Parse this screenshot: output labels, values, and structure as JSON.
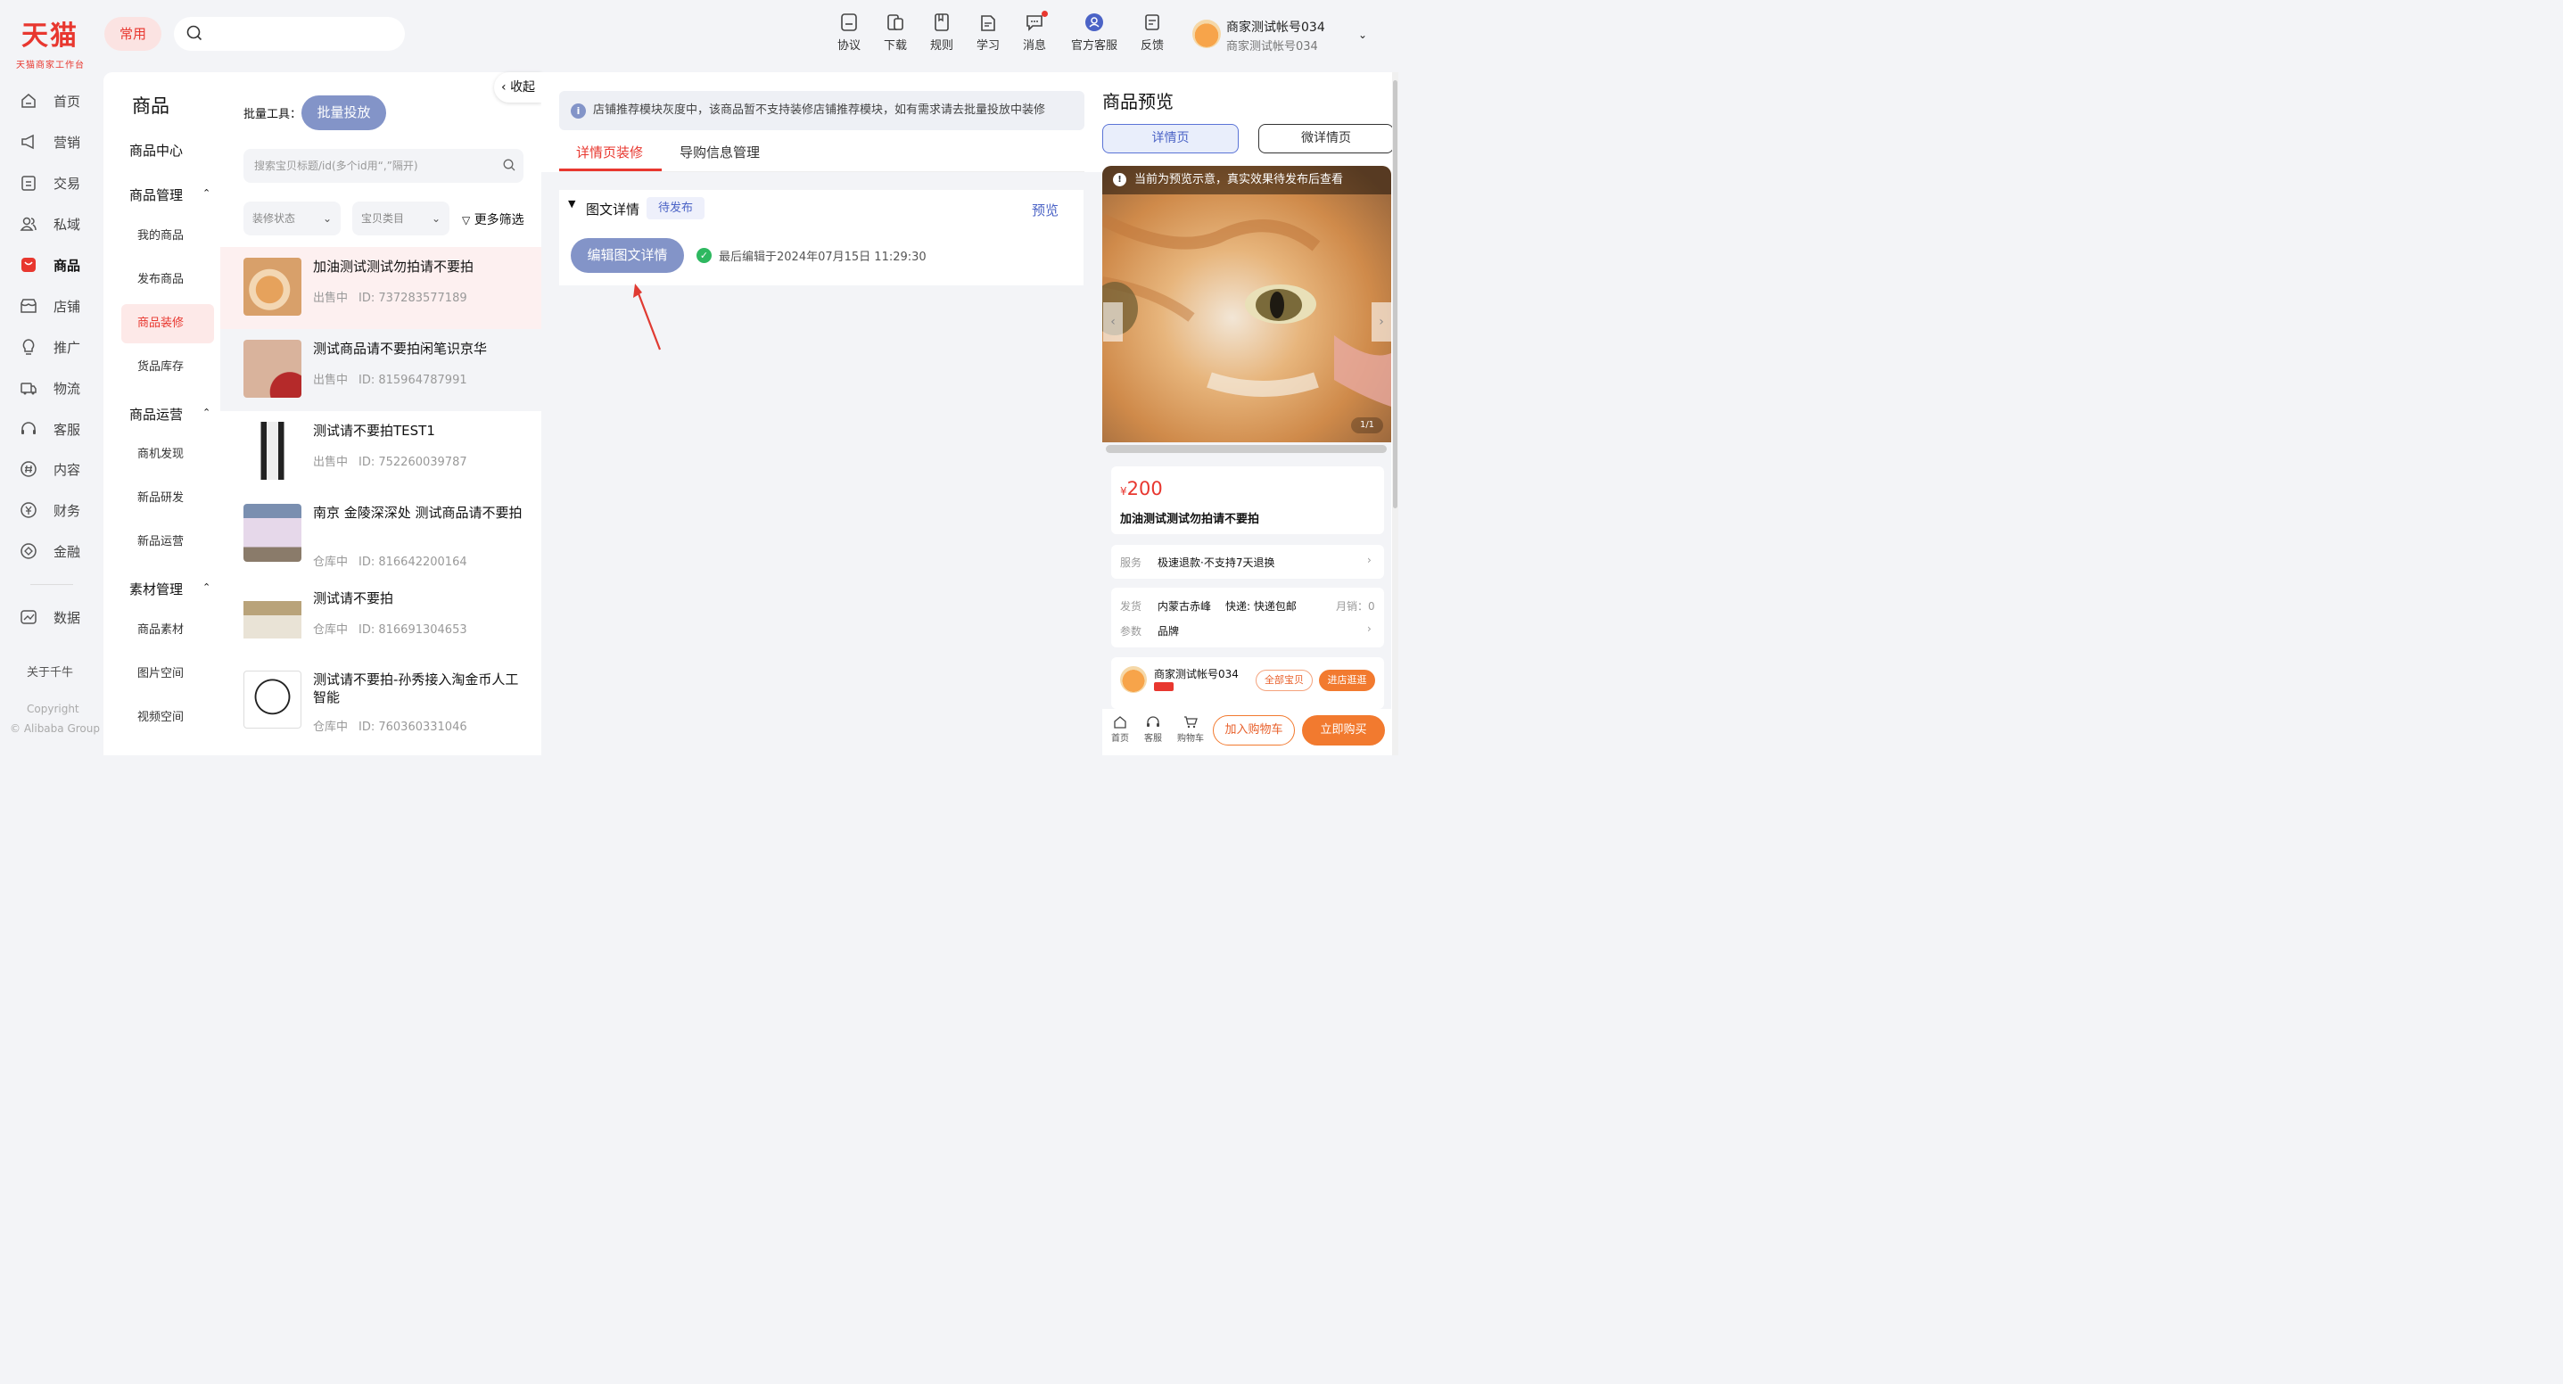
{
  "brand": {
    "name": "天猫",
    "subtitle": "天猫商家工作台"
  },
  "header": {
    "common_label": "常用",
    "search_placeholder": "",
    "tools": [
      {
        "label": "协议",
        "icon": "agreement-icon"
      },
      {
        "label": "下载",
        "icon": "download-icon"
      },
      {
        "label": "规则",
        "icon": "rules-icon"
      },
      {
        "label": "学习",
        "icon": "learn-icon"
      },
      {
        "label": "消息",
        "icon": "message-icon"
      },
      {
        "label": "官方客服",
        "icon": "support-icon"
      },
      {
        "label": "反馈",
        "icon": "feedback-icon"
      }
    ],
    "account_name": "商家测试帐号034",
    "account_sub": "商家测试帐号034"
  },
  "nav": {
    "items": [
      {
        "label": "首页",
        "icon": "home-icon"
      },
      {
        "label": "营销",
        "icon": "megaphone-icon"
      },
      {
        "label": "交易",
        "icon": "trade-icon"
      },
      {
        "label": "私域",
        "icon": "users-icon"
      },
      {
        "label": "商品",
        "icon": "product-icon"
      },
      {
        "label": "店铺",
        "icon": "store-icon"
      },
      {
        "label": "推广",
        "icon": "promote-icon"
      },
      {
        "label": "物流",
        "icon": "logistics-icon"
      },
      {
        "label": "客服",
        "icon": "headset-icon"
      },
      {
        "label": "内容",
        "icon": "content-icon"
      },
      {
        "label": "财务",
        "icon": "finance-icon"
      },
      {
        "label": "金融",
        "icon": "banking-icon"
      },
      {
        "label": "数据",
        "icon": "data-icon"
      }
    ],
    "about": "关于千牛",
    "copyright": "Copyright",
    "company": "© Alibaba Group"
  },
  "subnav": {
    "title": "商品",
    "center": "商品中心",
    "groups": [
      {
        "label": "商品管理",
        "items": [
          "我的商品",
          "发布商品",
          "商品装修",
          "货品库存"
        ]
      },
      {
        "label": "商品运营",
        "items": [
          "商机发现",
          "新品研发",
          "新品运营"
        ]
      },
      {
        "label": "素材管理",
        "items": [
          "商品素材",
          "图片空间",
          "视频空间"
        ]
      }
    ],
    "active": "商品装修"
  },
  "list": {
    "batch_label": "批量工具：",
    "batch_button": "批量投放",
    "collapse": "收起",
    "search_placeholder": "搜索宝贝标题/id(多个id用“,”隔开)",
    "filter_status": "装修状态",
    "filter_category": "宝贝类目",
    "more_filters": "更多筛选",
    "rows": [
      {
        "title": "加油测试测试勿拍请不要拍",
        "status": "出售中",
        "id": "ID: 737283577189"
      },
      {
        "title": "测试商品请不要拍闲笔识京华",
        "status": "出售中",
        "id": "ID: 815964787991"
      },
      {
        "title": "测试请不要拍TEST1",
        "status": "出售中",
        "id": "ID: 752260039787"
      },
      {
        "title": "南京 金陵深深处 测试商品请不要拍",
        "status": "仓库中",
        "id": "ID: 816642200164"
      },
      {
        "title": "测试请不要拍",
        "status": "仓库中",
        "id": "ID: 816691304653"
      },
      {
        "title": "测试请不要拍-孙秀接入淘金币人工智能",
        "status": "仓库中",
        "id": "ID: 760360331046"
      }
    ]
  },
  "main": {
    "notice": "店铺推荐模块灰度中，该商品暂不支持装修店铺推荐模块，如有需求请去批量投放中装修",
    "tabs": [
      "详情页装修",
      "导购信息管理"
    ],
    "detail_title": "图文详情",
    "pending_badge": "待发布",
    "preview_link": "预览",
    "edit_button": "编辑图文详情",
    "last_edit": "最后编辑于2024年07月15日 11:29:30"
  },
  "preview": {
    "title": "商品预览",
    "tab_detail": "详情页",
    "tab_micro": "微详情页",
    "banner": "当前为预览示意，真实效果待发布后查看",
    "counter": "1/1",
    "currency": "¥",
    "price": "200",
    "name": "加油测试测试勿拍请不要拍",
    "service_label": "服务",
    "service_value": "极速退款·不支持7天退换",
    "ship_label": "发货",
    "ship_from": "内蒙古赤峰",
    "ship_method": "快递: 快递包邮",
    "monthly_sales": "月销：0",
    "param_label": "参数",
    "param_value": "品牌",
    "shop_name": "商家测试帐号034",
    "all_items": "全部宝贝",
    "enter_shop": "进店逛逛",
    "bottom_home": "首页",
    "bottom_service": "客服",
    "bottom_cart": "购物车",
    "add_cart": "加入购物车",
    "buy_now": "立即购买"
  },
  "colors": {
    "brand_red": "#e8372f",
    "accent_blue": "#8394c8",
    "link_blue": "#4b63c6",
    "orange": "#f27a2f"
  }
}
